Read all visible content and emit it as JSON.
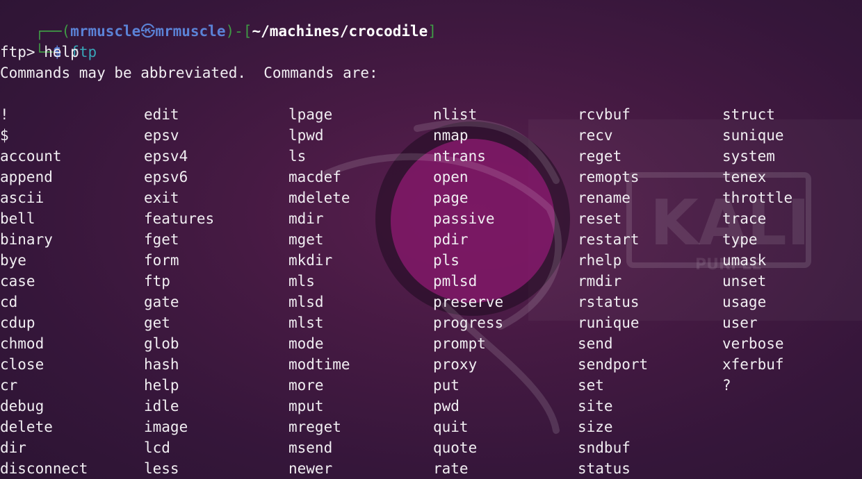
{
  "prompt": {
    "corner_top": "┌──",
    "open_paren": "(",
    "user": "mrmuscle",
    "at_symbol": "㉿",
    "host": "mrmuscle",
    "close_paren": ")",
    "dash": "-",
    "open_bracket": "[",
    "path": "~/machines/crocodile",
    "close_bracket": "]",
    "corner_bottom": "└─",
    "dollar": "$",
    "command": "ftp"
  },
  "ftp_prompt_line": "ftp> help",
  "intro_line": "Commands may be abbreviated.  Commands are:",
  "commands": {
    "col1": [
      "!",
      "$",
      "account",
      "append",
      "ascii",
      "bell",
      "binary",
      "bye",
      "case",
      "cd",
      "cdup",
      "chmod",
      "close",
      "cr",
      "debug",
      "delete",
      "dir",
      "disconnect"
    ],
    "col2": [
      "edit",
      "epsv",
      "epsv4",
      "epsv6",
      "exit",
      "features",
      "fget",
      "form",
      "ftp",
      "gate",
      "get",
      "glob",
      "hash",
      "help",
      "idle",
      "image",
      "lcd",
      "less"
    ],
    "col3": [
      "lpage",
      "lpwd",
      "ls",
      "macdef",
      "mdelete",
      "mdir",
      "mget",
      "mkdir",
      "mls",
      "mlsd",
      "mlst",
      "mode",
      "modtime",
      "more",
      "mput",
      "mreget",
      "msend",
      "newer"
    ],
    "col4": [
      "nlist",
      "nmap",
      "ntrans",
      "open",
      "page",
      "passive",
      "pdir",
      "pls",
      "pmlsd",
      "preserve",
      "progress",
      "prompt",
      "proxy",
      "put",
      "pwd",
      "quit",
      "quote",
      "rate"
    ],
    "col5": [
      "rcvbuf",
      "recv",
      "reget",
      "remopts",
      "rename",
      "reset",
      "restart",
      "rhelp",
      "rmdir",
      "rstatus",
      "runique",
      "send",
      "sendport",
      "set",
      "site",
      "size",
      "sndbuf",
      "status"
    ],
    "col6": [
      "struct",
      "sunique",
      "system",
      "tenex",
      "throttle",
      "trace",
      "type",
      "umask",
      "unset",
      "usage",
      "user",
      "verbose",
      "xferbuf",
      "?"
    ]
  },
  "watermark": {
    "logo_text": "KALI",
    "logo_subtext": "PURPLE",
    "accent_color": "#b01e8a"
  }
}
